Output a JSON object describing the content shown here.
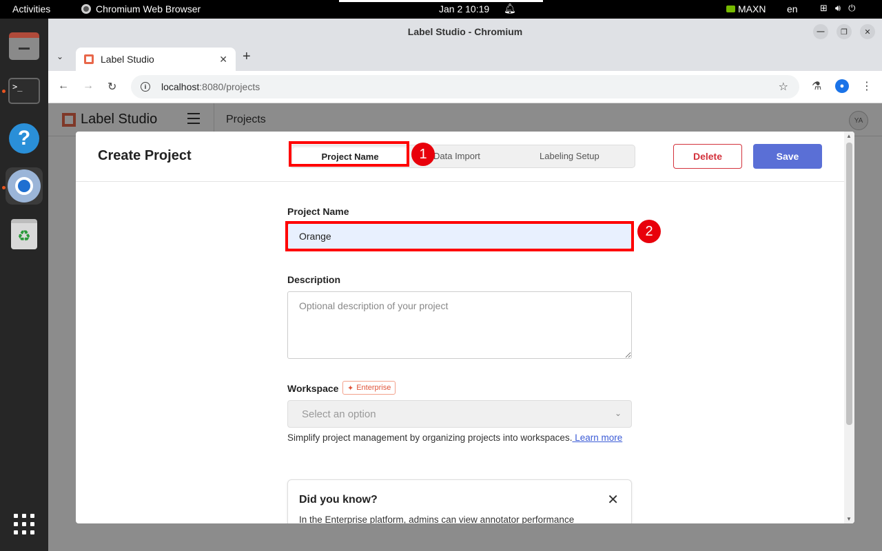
{
  "system": {
    "activities": "Activities",
    "app_name": "Chromium Web Browser",
    "clock": "Jan 2  10:19",
    "gpu_mode": "MAXN",
    "lang": "en"
  },
  "window": {
    "title": "Label Studio - Chromium"
  },
  "browser": {
    "tab_title": "Label Studio",
    "url_host": "localhost",
    "url_path": ":8080/projects"
  },
  "app": {
    "logo_text": "Label Studio",
    "breadcrumb": "Projects",
    "avatar_initials": "YA"
  },
  "modal": {
    "title": "Create Project",
    "steps": [
      "Project Name",
      "Data Import",
      "Labeling Setup"
    ],
    "delete_label": "Delete",
    "save_label": "Save",
    "annotations": [
      "1",
      "2"
    ],
    "form": {
      "name_label": "Project Name",
      "name_value": "Orange",
      "description_label": "Description",
      "description_placeholder": "Optional description of your project",
      "workspace_label": "Workspace",
      "enterprise_badge": "Enterprise",
      "workspace_placeholder": "Select an option",
      "workspace_help": "Simplify project management by organizing projects into workspaces.",
      "learn_more": " Learn more"
    },
    "tip": {
      "title": "Did you know?",
      "text": "In the Enterprise platform, admins can view annotator performance"
    }
  },
  "colors": {
    "accent": "#5a6fd6",
    "danger": "#d3313b",
    "brand": "#e8674a",
    "highlight": "#ff0000"
  }
}
